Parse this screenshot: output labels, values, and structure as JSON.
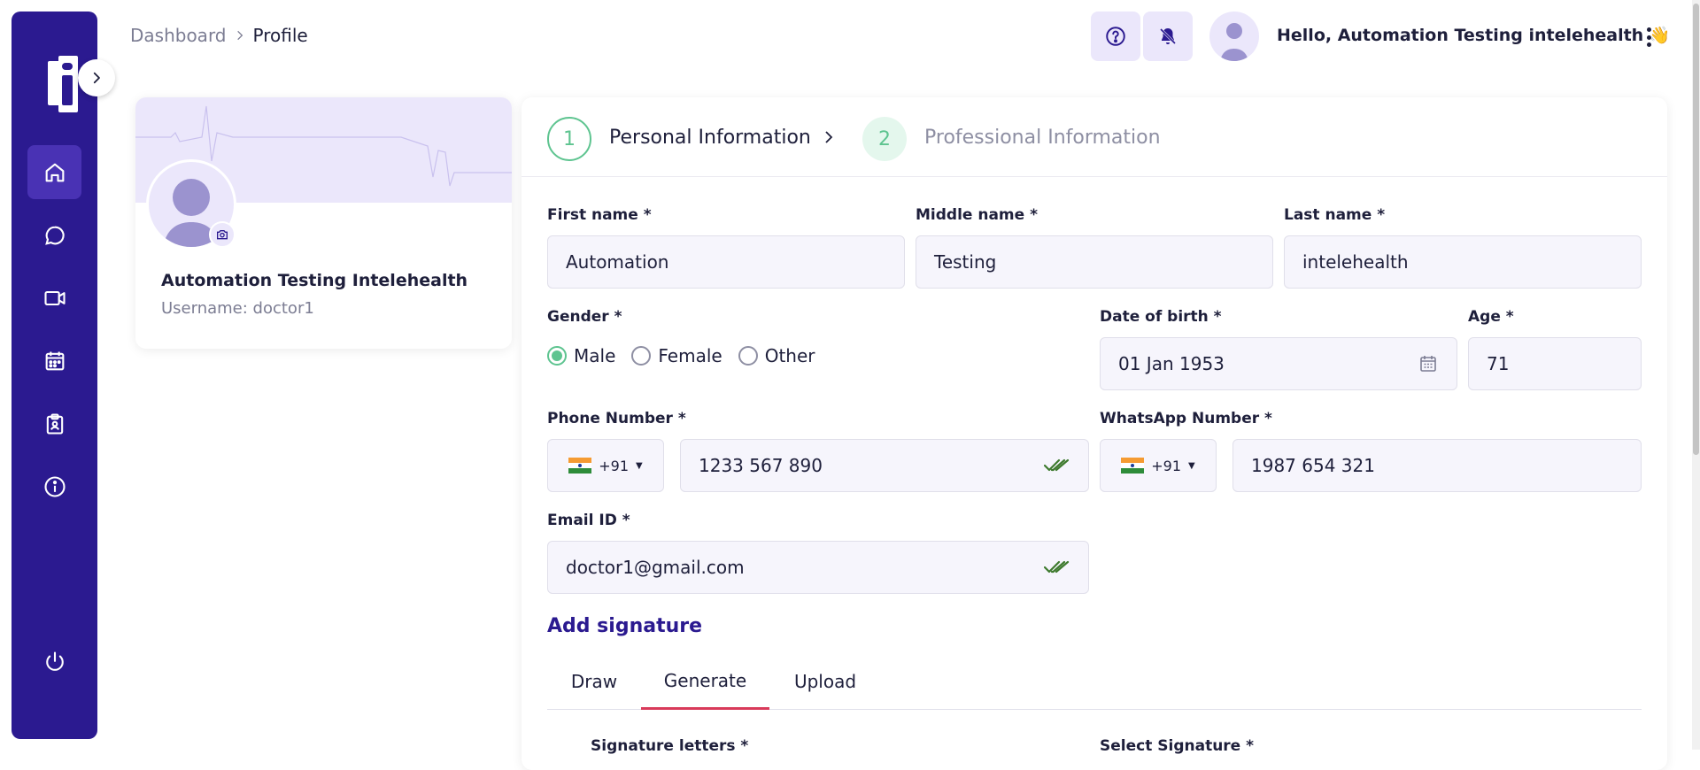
{
  "breadcrumb": {
    "root": "Dashboard",
    "current": "Profile"
  },
  "header": {
    "greeting": "Hello, Automation Testing intelehealth",
    "wave": "👋"
  },
  "profile": {
    "name": "Automation Testing Intelehealth",
    "username": "Username: doctor1"
  },
  "stepper": {
    "step1_num": "1",
    "step1_label": "Personal Information",
    "step2_num": "2",
    "step2_label": "Professional Information"
  },
  "form": {
    "first_name_label": "First name *",
    "first_name": "Automation",
    "middle_name_label": "Middle name *",
    "middle_name": "Testing",
    "last_name_label": "Last name *",
    "last_name": "intelehealth",
    "gender_label": "Gender *",
    "gender_options": [
      "Male",
      "Female",
      "Other"
    ],
    "gender_selected": "Male",
    "dob_label": "Date of birth *",
    "dob": "01 Jan 1953",
    "age_label": "Age *",
    "age": "71",
    "phone_label": "Phone Number *",
    "phone_code": "+91",
    "phone": "1233 567 890",
    "whatsapp_label": "WhatsApp Number *",
    "whatsapp_code": "+91",
    "whatsapp": "1987 654 321",
    "email_label": "Email ID *",
    "email": "doctor1@gmail.com"
  },
  "signature": {
    "title": "Add signature",
    "tabs": [
      "Draw",
      "Generate",
      "Upload"
    ],
    "active_tab": "Generate",
    "letters_label": "Signature letters *",
    "select_label": "Select Signature *"
  },
  "colors": {
    "sidebar": "#2b1a90",
    "accent_green": "#5ec490",
    "tab_active": "#d93a5a",
    "link": "#2b1a90"
  },
  "icons": {
    "sidebar": [
      "home-icon",
      "chat-icon",
      "video-icon",
      "calendar-icon",
      "clipboard-icon",
      "info-icon",
      "power-icon"
    ],
    "header": [
      "help-icon",
      "notifications-off-icon"
    ]
  }
}
